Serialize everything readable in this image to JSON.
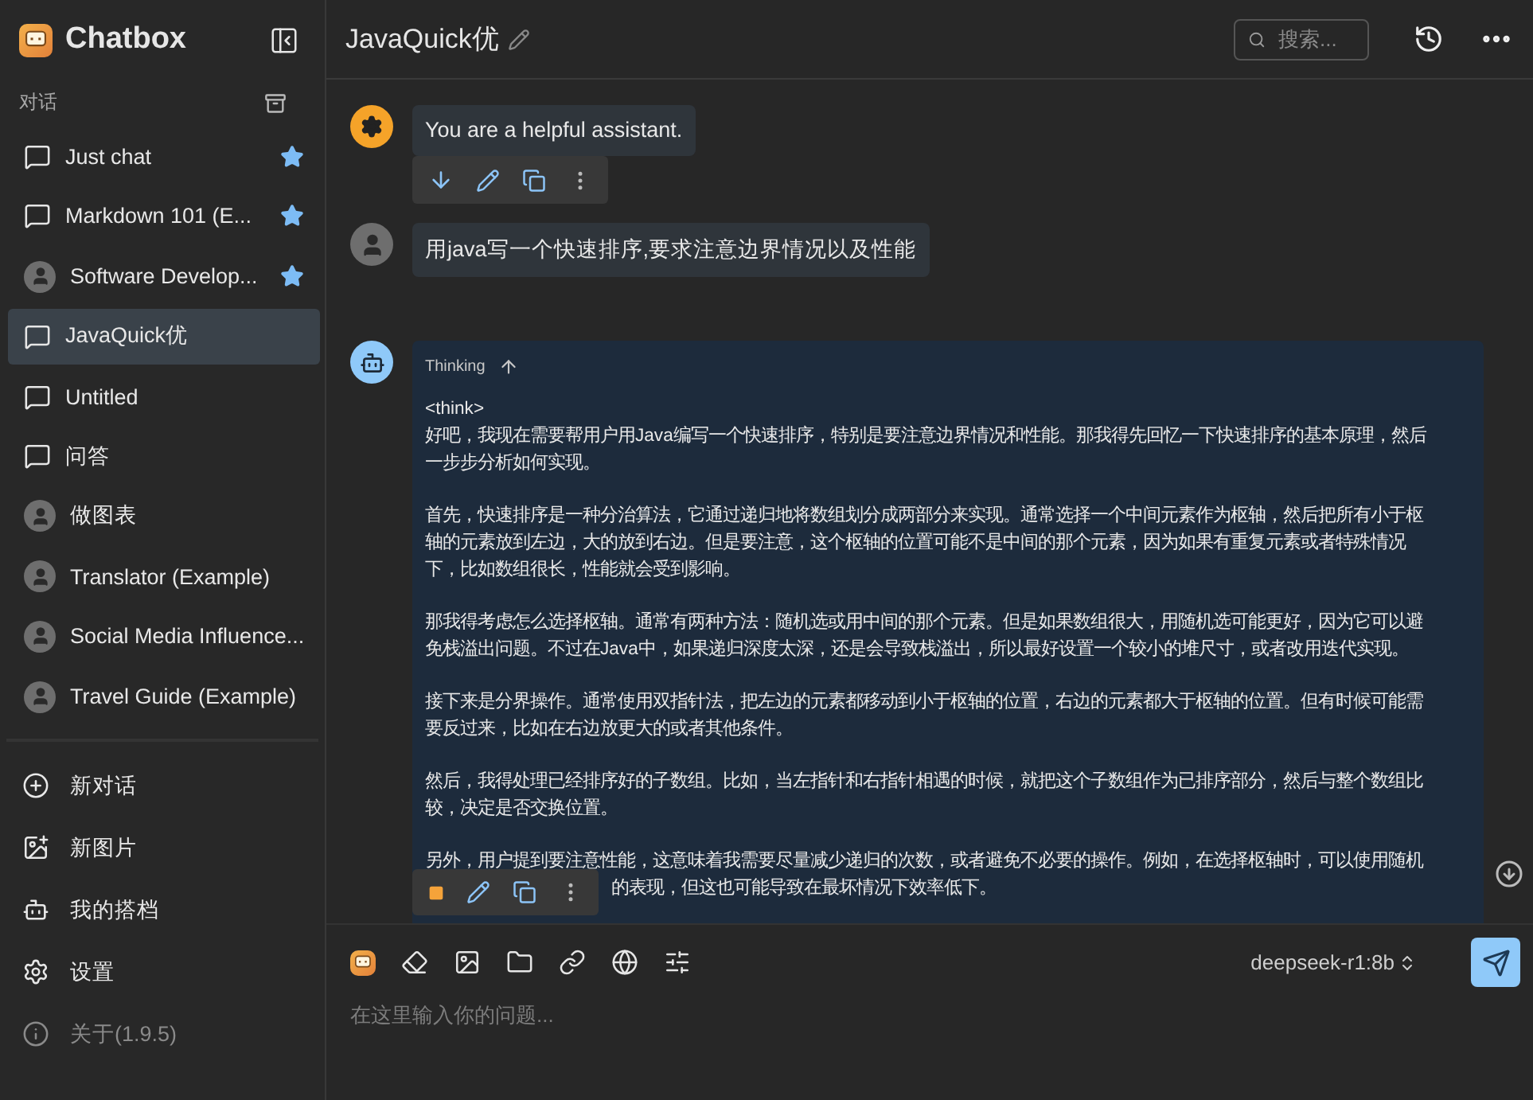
{
  "app": {
    "name": "Chatbox"
  },
  "sidebar": {
    "section_label": "对话",
    "conversations": [
      {
        "title": "Just chat",
        "kind": "chat",
        "starred": true,
        "selected": false
      },
      {
        "title": "Markdown 101 (E...",
        "kind": "chat",
        "starred": true,
        "selected": false
      },
      {
        "title": "Software Develop...",
        "kind": "persona",
        "starred": true,
        "selected": false
      },
      {
        "title": "JavaQuick优",
        "kind": "chat",
        "starred": false,
        "selected": true
      },
      {
        "title": "Untitled",
        "kind": "chat",
        "starred": false,
        "selected": false
      },
      {
        "title": "问答",
        "kind": "chat",
        "starred": false,
        "selected": false
      },
      {
        "title": "做图表",
        "kind": "persona",
        "starred": false,
        "selected": false
      },
      {
        "title": "Translator (Example)",
        "kind": "persona",
        "starred": false,
        "selected": false
      },
      {
        "title": "Social Media Influence...",
        "kind": "persona",
        "starred": false,
        "selected": false
      },
      {
        "title": "Travel Guide (Example)",
        "kind": "persona",
        "starred": false,
        "selected": false
      }
    ],
    "menu": [
      {
        "label": "新对话",
        "kind": "new-chat",
        "dimmed": false
      },
      {
        "label": "新图片",
        "kind": "new-image",
        "dimmed": false
      },
      {
        "label": "我的搭档",
        "kind": "partners",
        "dimmed": false
      },
      {
        "label": "设置",
        "kind": "settings",
        "dimmed": false
      },
      {
        "label": "关于(1.9.5)",
        "kind": "about",
        "dimmed": true
      }
    ]
  },
  "header": {
    "title": "JavaQuick优",
    "search": {
      "placeholder": "搜索..."
    }
  },
  "messages": [
    {
      "kind": "system",
      "text": "You are a helpful assistant.",
      "toolbar": true
    },
    {
      "kind": "user",
      "text": "用java写一个快速排序,要求注意边界情况以及性能",
      "toolbar": false
    },
    {
      "kind": "assistant",
      "toolbar": true,
      "generating": true,
      "thinking_label": "Thinking",
      "paragraphs": [
        [
          "<think>",
          "好吧，我现在需要帮用户用Java编写一个快速排序，特别是要注意边界情况和性能。那我得先回忆一下快速排序的基本原理，然后",
          "一步步分析如何实现。"
        ],
        [
          "首先，快速排序是一种分治算法，它通过递归地将数组划分成两部分来实现。通常选择一个中间元素作为枢轴，然后把所有小于枢",
          "轴的元素放到左边，大的放到右边。但是要注意，这个枢轴的位置可能不是中间的那个元素，因为如果有重复元素或者特殊情况",
          "下，比如数组很长，性能就会受到影响。"
        ],
        [
          "那我得考虑怎么选择枢轴。通常有两种方法：随机选或用中间的那个元素。但是如果数组很大，用随机选可能更好，因为它可以避",
          "免栈溢出问题。不过在Java中，如果递归深度太深，还是会导致栈溢出，所以最好设置一个较小的堆尺寸，或者改用迭代实现。"
        ],
        [
          "接下来是分界操作。通常使用双指针法，把左边的元素都移动到小于枢轴的位置，右边的元素都大于枢轴的位置。但有时候可能需",
          "要反过来，比如在右边放更大的或者其他条件。"
        ],
        [
          "然后，我得处理已经排序好的子数组。比如，当左指针和右指针相遇的时候，就把这个子数组作为已排序部分，然后与整个数组比",
          "较，决定是否交换位置。"
        ],
        [
          "另外，用户提到要注意性能，这意味着我需要尽量减少递归的次数，或者避免不必要的操作。例如，在选择枢轴时，可以使用随机"
        ]
      ],
      "partial_line": "的表现，但这也可能导致在最坏情况下效率低下。"
    }
  ],
  "composer": {
    "model": "deepseek-r1:8b",
    "placeholder": "在这里输入你的问题..."
  }
}
